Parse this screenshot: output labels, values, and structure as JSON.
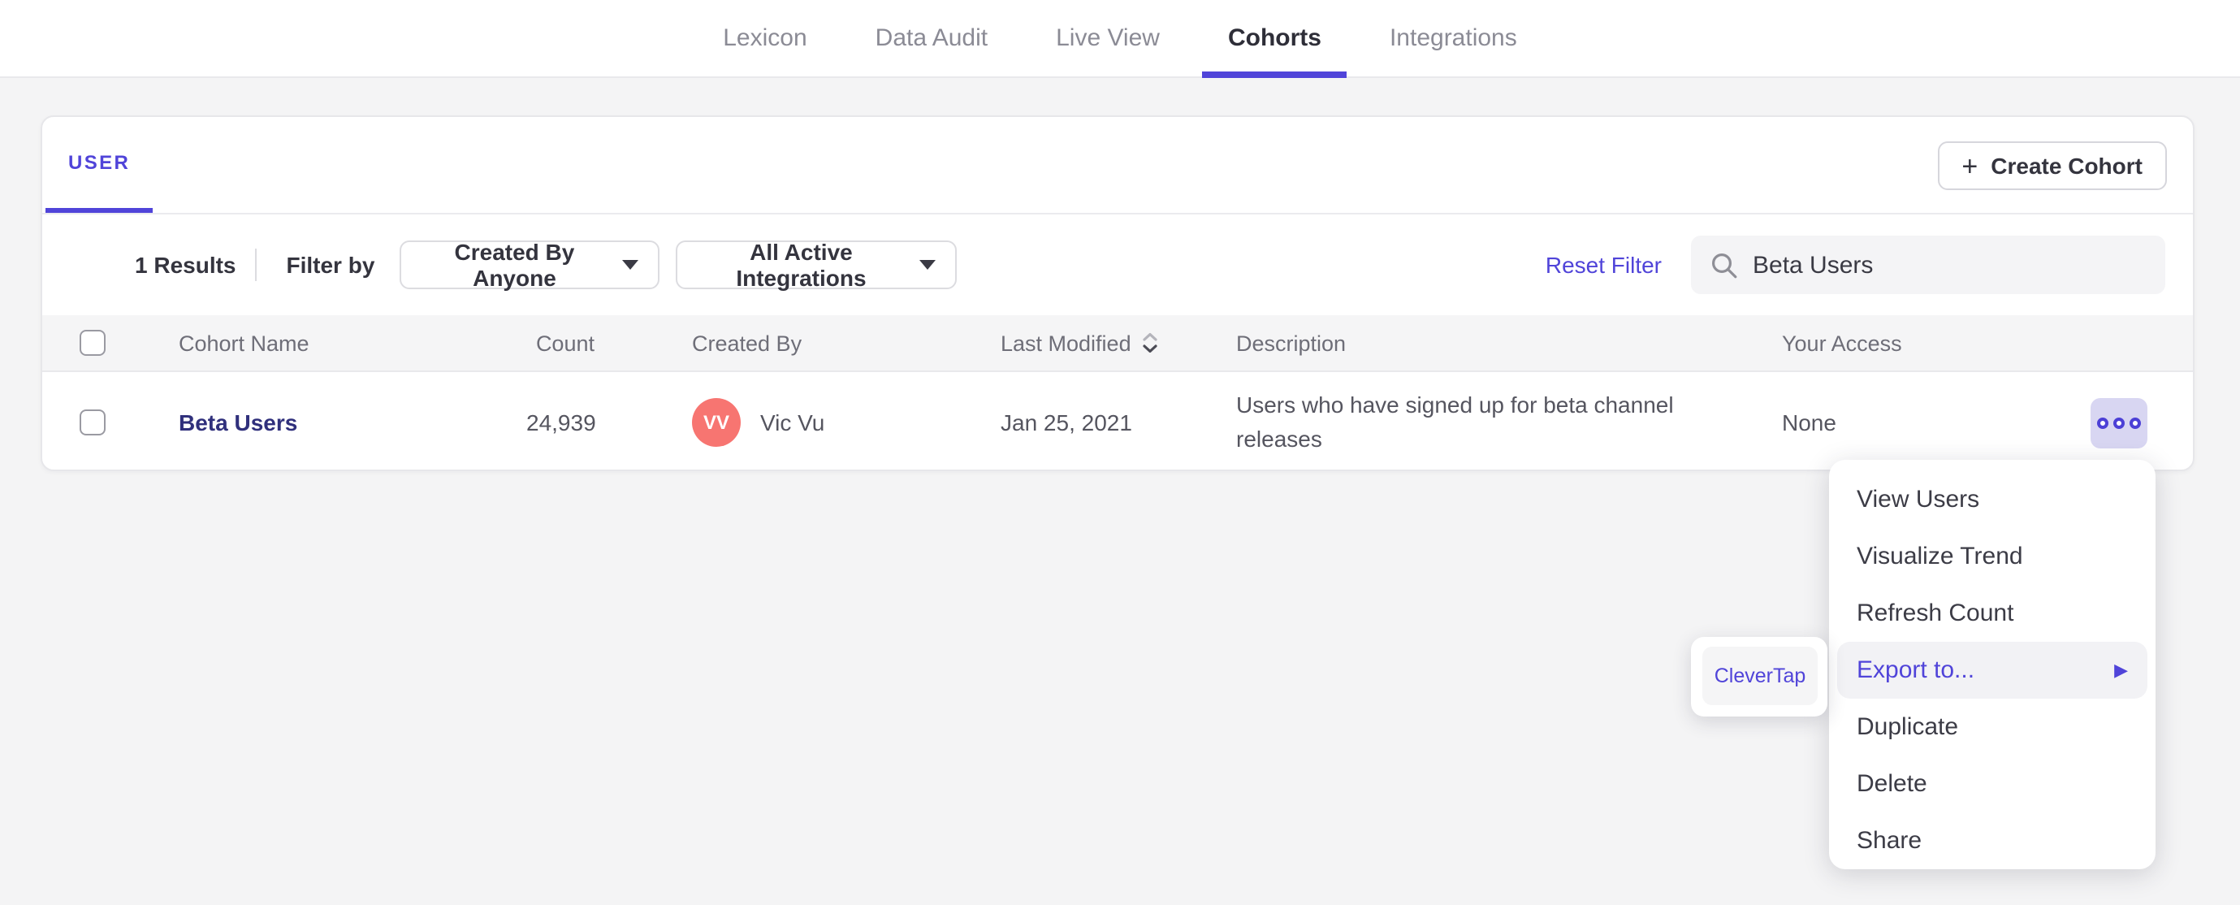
{
  "nav": {
    "items": [
      {
        "label": "Lexicon"
      },
      {
        "label": "Data Audit"
      },
      {
        "label": "Live View"
      },
      {
        "label": "Cohorts"
      },
      {
        "label": "Integrations"
      }
    ],
    "active": "Cohorts"
  },
  "card": {
    "tab_label": "USER",
    "create_button_label": "Create Cohort",
    "filter": {
      "results": "1 Results",
      "filter_by_label": "Filter by",
      "created_by_value": "Created By Anyone",
      "integrations_value": "All Active Integrations",
      "reset_label": "Reset Filter",
      "search_value": "Beta Users"
    },
    "table": {
      "headers": [
        "Cohort Name",
        "Count",
        "Created By",
        "Last Modified",
        "Description",
        "Your Access"
      ],
      "row": {
        "name": "Beta Users",
        "count": "24,939",
        "avatar_initials": "VV",
        "created_by": "Vic Vu",
        "last_modified": "Jan 25, 2021",
        "description": "Users who have signed up for beta channel releases",
        "your_access": "None"
      }
    }
  },
  "menu": {
    "items": [
      "View Users",
      "Visualize Trend",
      "Refresh Count",
      "Export to...",
      "Duplicate",
      "Delete",
      "Share"
    ]
  },
  "submenu": {
    "items": [
      "CleverTap"
    ]
  },
  "colors": {
    "accent": "#5044d9",
    "cohort_link": "#30307c",
    "avatar": "#f77571",
    "actions_button_bg": "#d8d6f2",
    "menu_highlight_bg": "#f2f2f5",
    "header_bg": "#f5f5f6",
    "page_bg": "#f4f4f5"
  }
}
